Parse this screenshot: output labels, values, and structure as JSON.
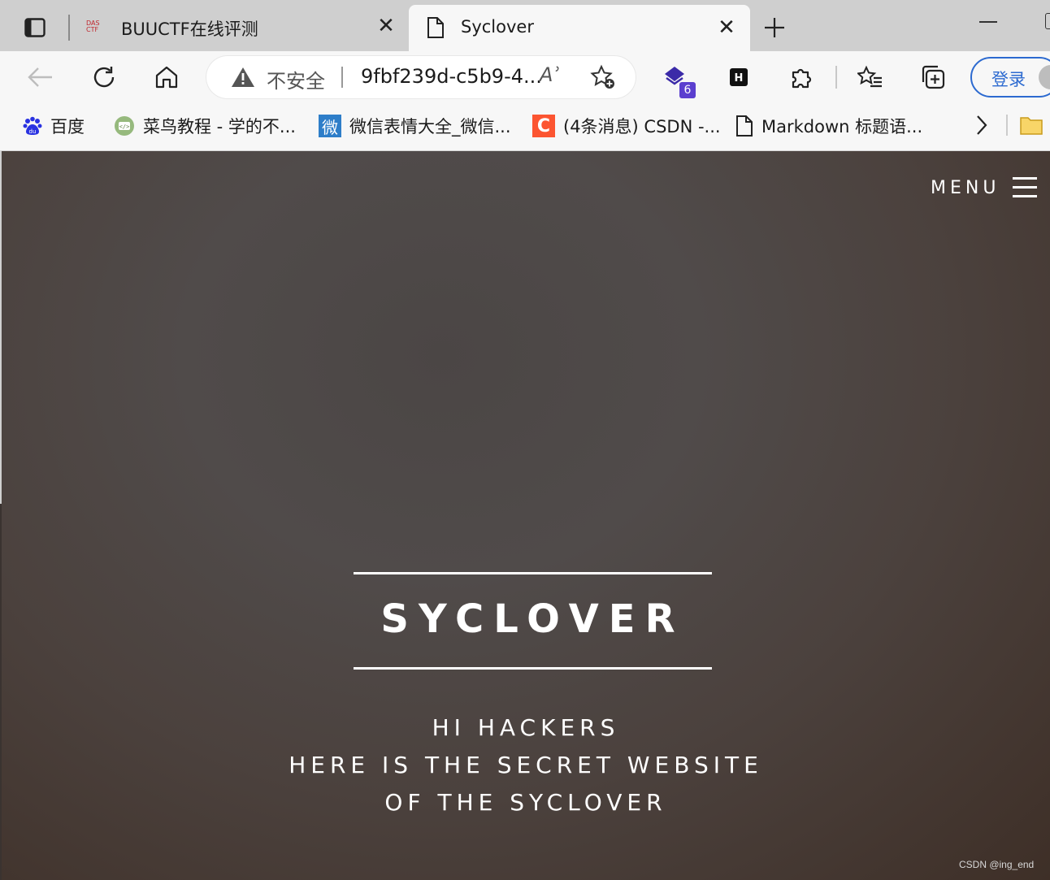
{
  "browser": {
    "tabs": [
      {
        "title": "BUUCTF在线评测",
        "favicon": "buuctf-logo-icon",
        "active": false
      },
      {
        "title": "Syclover",
        "favicon": "page-icon",
        "active": true
      }
    ],
    "address_bar": {
      "security_label": "不安全",
      "url": "9fbf239d-c5b9-4...",
      "read_aloud": "Aʾ"
    },
    "extension_badge": "6",
    "extension_h_label": "H",
    "login_label": "登录",
    "bookmarks": [
      {
        "label": "百度",
        "icon": "baidu-icon"
      },
      {
        "label": "菜鸟教程 - 学的不...",
        "icon": "runoob-icon"
      },
      {
        "label": "微信表情大全_微信...",
        "icon": "wechat-emoji-icon",
        "icon_text": "微"
      },
      {
        "label": "(4条消息) CSDN -...",
        "icon": "csdn-icon",
        "icon_text": "C"
      },
      {
        "label": "Markdown 标题语...",
        "icon": "page-icon"
      }
    ]
  },
  "page": {
    "menu_label": "MENU",
    "title": "SYCLOVER",
    "lines": [
      "HI HACKERS",
      "HERE IS THE SECRET WEBSITE",
      "OF THE SYCLOVER"
    ]
  },
  "watermark": "CSDN @ing_end",
  "colors": {
    "accent": "#2c6ad0",
    "hero_text": "#ffffff",
    "csdn": "#fc5531",
    "ext_purple": "#5b3fcf"
  }
}
